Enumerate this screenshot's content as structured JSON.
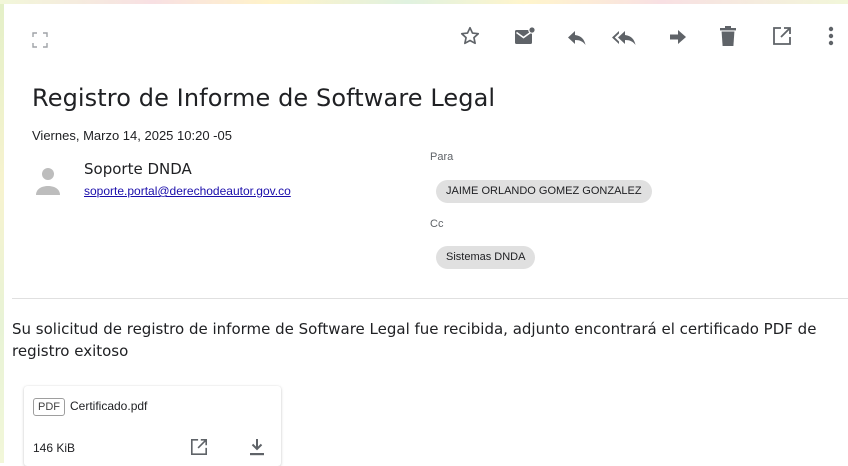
{
  "toolbar": {
    "icons": [
      "expand-icon",
      "star-icon",
      "mark-unread-icon",
      "reply-icon",
      "reply-all-icon",
      "forward-icon",
      "delete-icon",
      "open-new-window-icon",
      "more-options-icon"
    ]
  },
  "email": {
    "subject": "Registro de Informe de Software Legal",
    "date": "Viernes, Marzo 14, 2025 10:20 -05",
    "sender": {
      "name": "Soporte DNDA",
      "email": "soporte.portal@derechodeautor.gov.co"
    },
    "to_label": "Para",
    "to": [
      "JAIME ORLANDO GOMEZ GONZALEZ"
    ],
    "cc_label": "Cc",
    "cc": [
      "Sistemas DNDA"
    ],
    "body": "Su solicitud de registro de informe de Software Legal fue recibida, adjunto encontrará el certificado PDF de registro exitoso"
  },
  "attachment": {
    "type": "PDF",
    "filename": "Certificado.pdf",
    "size": "146 KiB"
  },
  "colors": {
    "link": "#1a0dab",
    "icon": "#5f6368",
    "chip_bg": "#e0e0e0"
  }
}
